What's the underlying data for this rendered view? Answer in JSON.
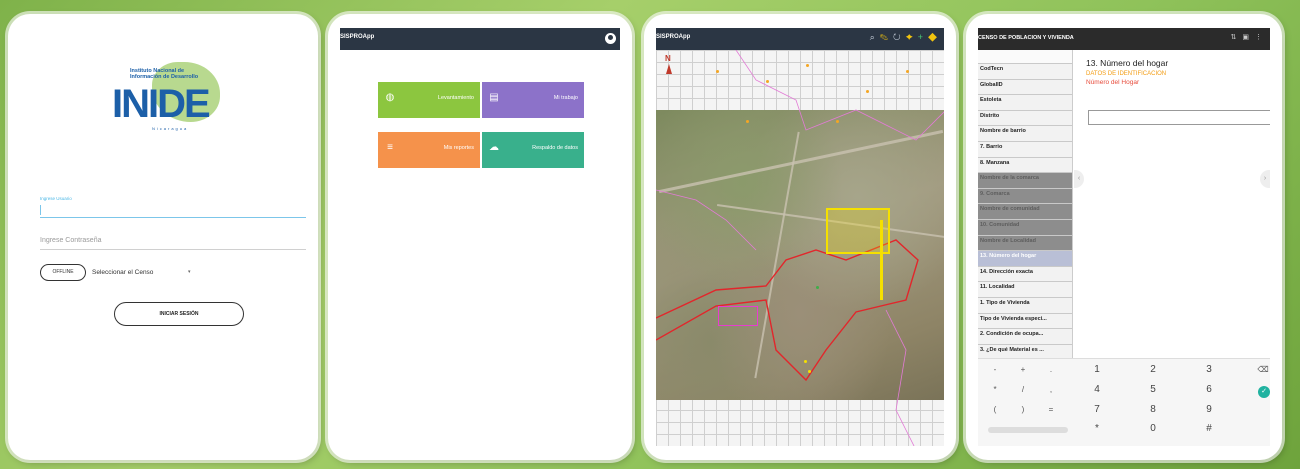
{
  "login": {
    "logo_word": "INIDE",
    "logo_sub_line1": "Instituto Nacional de",
    "logo_sub_line2": "Información de Desarrollo",
    "logo_small": "Nicaragua",
    "user_label": "Ingrese Usuario",
    "password_placeholder": "Ingrese Contraseña",
    "offline_label": "OFFLINE",
    "census_select": "Seleccionar el Censo",
    "login_button": "INICIAR SESIÓN"
  },
  "home": {
    "app_title": "SISPROApp",
    "tiles": [
      {
        "label": "Levantamiento",
        "icon": "globe-icon",
        "color": "#8cc63f"
      },
      {
        "label": "Mi trabajo",
        "icon": "clipboard-icon",
        "color": "#8c72c9"
      },
      {
        "label": "Mis reportes",
        "icon": "report-icon",
        "color": "#f5924b"
      },
      {
        "label": "Respaldo de datos",
        "icon": "cloud-upload-icon",
        "color": "#39b08c"
      }
    ]
  },
  "map": {
    "app_title": "SISPROApp",
    "compass": "N"
  },
  "census": {
    "title": "CENSO DE POBLACION Y VIVIENDA",
    "question_title": "13. Número del hogar",
    "section": "DATOS DE IDENTIFICACION",
    "subtitle": "Número del Hogar",
    "questions": [
      {
        "label": "CodTecn",
        "state": "normal"
      },
      {
        "label": "GlobalID",
        "state": "normal"
      },
      {
        "label": "Estoleta",
        "state": "normal"
      },
      {
        "label": "Distrito",
        "state": "normal"
      },
      {
        "label": "Nombre de barrio",
        "state": "normal"
      },
      {
        "label": "7. Barrio",
        "state": "normal"
      },
      {
        "label": "8. Manzana",
        "state": "normal"
      },
      {
        "label": "Nombre de la comarca",
        "state": "dim"
      },
      {
        "label": "9. Comarca",
        "state": "dim"
      },
      {
        "label": "Nombre de comunidad",
        "state": "dim"
      },
      {
        "label": "10. Comunidad",
        "state": "dim"
      },
      {
        "label": "Nombre de Localidad",
        "state": "dim"
      },
      {
        "label": "13. Número del hogar",
        "state": "active"
      },
      {
        "label": "14. Dirección exacta",
        "state": "normal"
      },
      {
        "label": "11. Localidad",
        "state": "normal"
      },
      {
        "label": "1. Tipo de Vivienda",
        "state": "normal"
      },
      {
        "label": "Tipo de Vivienda especi...",
        "state": "normal"
      },
      {
        "label": "2. Condición de ocupa...",
        "state": "normal"
      },
      {
        "label": "3. ¿De qué Material es ...",
        "state": "normal"
      }
    ],
    "keys": {
      "r1": [
        "-",
        "+",
        ".",
        "1",
        "2",
        "3"
      ],
      "r2": [
        "*",
        "/",
        ",",
        "4",
        "5",
        "6"
      ],
      "r3": [
        "(",
        ")",
        "=",
        "7",
        "8",
        "9"
      ],
      "r4": [
        "*",
        "0",
        "#"
      ]
    }
  }
}
